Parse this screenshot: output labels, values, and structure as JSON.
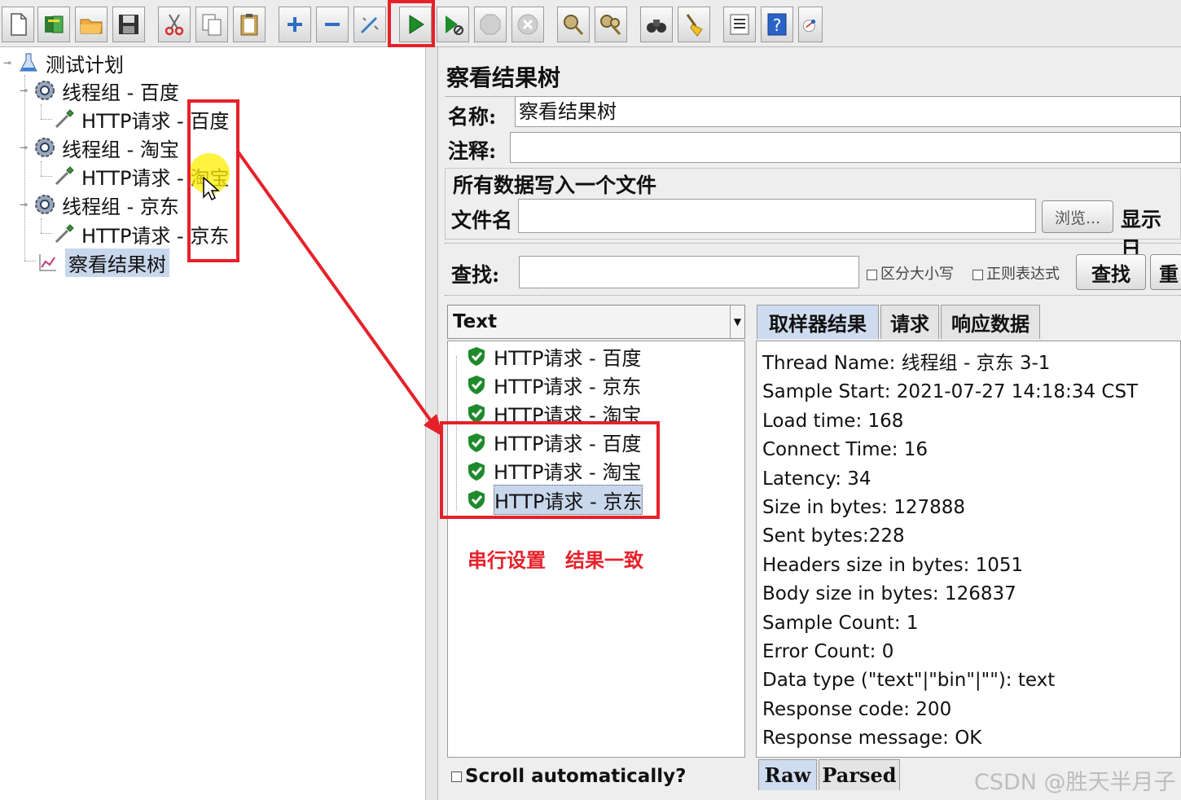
{
  "tree": {
    "plan": "测试计划",
    "group1": "线程组 - 百度",
    "req1_prefix": "HTTP请求 - ",
    "req1_suffix": "百度",
    "group2": "线程组 - 淘宝",
    "req2_prefix": "HTTP请求 - ",
    "req2_suffix": "淘宝",
    "group3": "线程组 - 京东",
    "req3_prefix": "HTTP请求 - ",
    "req3_suffix": "京东",
    "listener": "察看结果树"
  },
  "panel": {
    "title": "察看结果树",
    "name_label": "名称:",
    "name_value": "察看结果树",
    "comment_label": "注释:",
    "comment_value": "",
    "file_group": "所有数据写入一个文件",
    "file_label": "文件名",
    "file_value": "",
    "browse_button": "浏览...",
    "display_log": "显示日",
    "search_label": "查找:",
    "search_value": "",
    "case_sensitive": "区分大小写",
    "regex": "正则表达式",
    "search_button": "查找",
    "reset_button": "重"
  },
  "renderer": {
    "selected": "Text"
  },
  "results": [
    "HTTP请求 - 百度",
    "HTTP请求 - 京东",
    "HTTP请求 - 淘宝",
    "HTTP请求 - 百度",
    "HTTP请求 - 淘宝",
    "HTTP请求 - 京东"
  ],
  "tabs": {
    "sampler": "取样器结果",
    "request": "请求",
    "response": "响应数据"
  },
  "details": [
    "Thread Name: 线程组 - 京东 3-1",
    "Sample Start: 2021-07-27 14:18:34 CST",
    "Load time: 168",
    "Connect Time: 16",
    "Latency: 34",
    "Size in bytes: 127888",
    "Sent bytes:228",
    "Headers size in bytes: 1051",
    "Body size in bytes: 126837",
    "Sample Count: 1",
    "Error Count: 0",
    "Data type (\"text\"|\"bin\"|\"\"): text",
    "Response code: 200",
    "Response message: OK"
  ],
  "scroll_auto": "Scroll automatically?",
  "bottom_tabs": {
    "raw": "Raw",
    "parsed": "Parsed"
  },
  "annotation": "串行设置　结果一致",
  "watermark": "CSDN @胜天半月子",
  "colors": {
    "annotation_red": "#e6212a",
    "selection": "#c9d7ec",
    "shield_green": "#1f8a2c"
  }
}
